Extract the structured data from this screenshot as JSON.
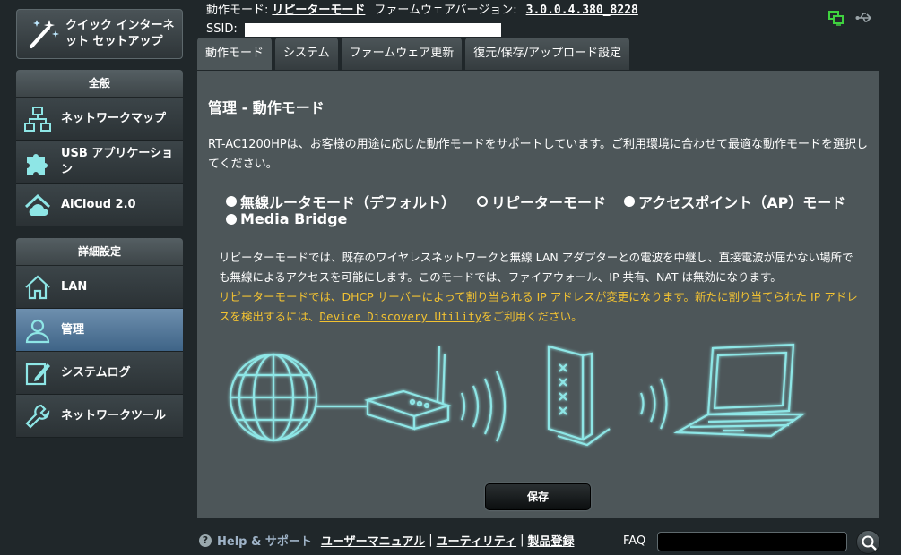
{
  "sidebar": {
    "quick_setup_label": "クイック インターネット セットアップ",
    "general_header": "全般",
    "general_items": [
      {
        "label": "ネットワークマップ",
        "icon": "network-map-icon"
      },
      {
        "label": "USB アプリケーション",
        "icon": "usb-application-icon"
      },
      {
        "label": "AiCloud 2.0",
        "icon": "aicloud-icon"
      }
    ],
    "advanced_header": "詳細設定",
    "advanced_items": [
      {
        "label": "LAN",
        "icon": "home-icon",
        "active": false
      },
      {
        "label": "管理",
        "icon": "admin-user-icon",
        "active": true
      },
      {
        "label": "システムログ",
        "icon": "system-log-icon",
        "active": false
      },
      {
        "label": "ネットワークツール",
        "icon": "network-tools-icon",
        "active": false
      }
    ]
  },
  "topbar": {
    "op_mode_label": "動作モード:",
    "op_mode_value": "リピーターモード",
    "firmware_label": "ファームウェアバージョン:",
    "firmware_value": "3.0.0.4.380_8228",
    "ssid_label": "SSID:",
    "ssid_value": ""
  },
  "tabs": [
    {
      "label": "動作モード",
      "active": true
    },
    {
      "label": "システム",
      "active": false
    },
    {
      "label": "ファームウェア更新",
      "active": false
    },
    {
      "label": "復元/保存/アップロード設定",
      "active": false
    }
  ],
  "main": {
    "title": "管理 - 動作モード",
    "intro": "RT-AC1200HPは、お客様の用途に応じた動作モードをサポートしています。ご利用環境に合わせて最適な動作モードを選択してください。",
    "modes": [
      {
        "label": "無線ルータモード（デフォルト）",
        "selected": false
      },
      {
        "label": "リピーターモード",
        "selected": true
      },
      {
        "label": "アクセスポイント（AP）モード",
        "selected": false
      },
      {
        "label": "Media Bridge",
        "selected": false
      }
    ],
    "description": "リピーターモードでは、既存のワイヤレスネットワークと無線 LAN アダプターとの電波を中継し、直接電波が届かない場所でも無線によるアクセスを可能にします。このモードでは、ファイアウォール、IP 共有、NAT は無効になります。",
    "warning_prefix": "リピーターモードでは、DHCP サーバーによって割り当られる IP アドレスが変更になります。新たに割り当てられた IP アドレスを検出するには、",
    "warning_link": "Device Discovery Utility",
    "warning_suffix": "をご利用ください。",
    "save_label": "保存"
  },
  "footer": {
    "help_label": "Help & サポート",
    "links": [
      "ユーザーマニュアル",
      "ユーティリティ",
      "製品登録"
    ],
    "faq_label": "FAQ",
    "faq_value": ""
  },
  "colors": {
    "panel_bg": "#4d5659",
    "page_bg": "#20272a",
    "accent_active": "#4f769c",
    "warning": "#f2c232",
    "line_art": "#8ee6e6"
  }
}
